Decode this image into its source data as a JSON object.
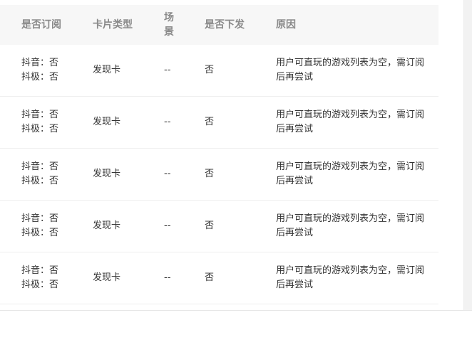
{
  "table": {
    "headers": {
      "subscribed": "是否订阅",
      "card_type": "卡片类型",
      "scene": "场景",
      "issued": "是否下发",
      "reason": "原因"
    },
    "rows": [
      {
        "douyin": "抖音：否",
        "doují": "抖极：否",
        "card_type": "发现卡",
        "scene": "--",
        "issued": "否",
        "reason": "用户可直玩的游戏列表为空，需订阅后再尝试"
      },
      {
        "douyin": "抖音：否",
        "doují": "抖极：否",
        "card_type": "发现卡",
        "scene": "--",
        "issued": "否",
        "reason": "用户可直玩的游戏列表为空，需订阅后再尝试"
      },
      {
        "douyin": "抖音：否",
        "doují": "抖极：否",
        "card_type": "发现卡",
        "scene": "--",
        "issued": "否",
        "reason": "用户可直玩的游戏列表为空，需订阅后再尝试"
      },
      {
        "douyin": "抖音：否",
        "doují": "抖极：否",
        "card_type": "发现卡",
        "scene": "--",
        "issued": "否",
        "reason": "用户可直玩的游戏列表为空，需订阅后再尝试"
      },
      {
        "douyin": "抖音：否",
        "doují": "抖极：否",
        "card_type": "发现卡",
        "scene": "--",
        "issued": "否",
        "reason": "用户可直玩的游戏列表为空，需订阅后再尝试"
      }
    ]
  }
}
